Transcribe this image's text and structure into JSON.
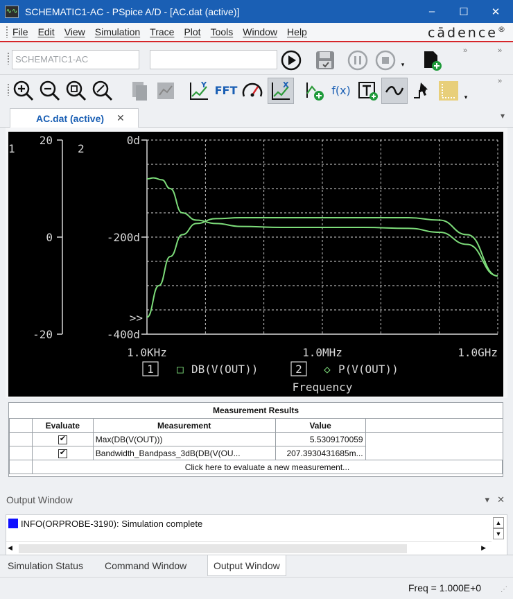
{
  "window": {
    "title": "SCHEMATIC1-AC - PSpice A/D  - [AC.dat (active)]",
    "minimize": "–",
    "maximize": "☐",
    "close": "✕"
  },
  "menu": {
    "items": [
      "File",
      "Edit",
      "View",
      "Simulation",
      "Trace",
      "Plot",
      "Tools",
      "Window",
      "Help"
    ],
    "brand": "cādence",
    "brand_mark": "®"
  },
  "toolbar": {
    "profile_value": "SCHEMATIC1-AC",
    "second_combo_value": "",
    "fft_label": "FFT",
    "fx_label": "f(x)",
    "chevron": "»"
  },
  "tabs": {
    "active_label": "AC.dat (active)",
    "close": "✕",
    "dropdown": "▾"
  },
  "plot": {
    "axis1_id": "1",
    "axis2_id": "2",
    "y1_ticks": [
      "20",
      "0",
      "-20"
    ],
    "y2_ticks": [
      "0d",
      "-200d",
      "-400d"
    ],
    "x_ticks": [
      "1.0KHz",
      "1.0MHz",
      "1.0GHz"
    ],
    "overflow_marker": ">>",
    "legend": [
      {
        "id": "1",
        "symbol": "□",
        "label": "DB(V(OUT))"
      },
      {
        "id": "2",
        "symbol": "◇",
        "label": "P(V(OUT))"
      }
    ],
    "xlabel": "Frequency",
    "colors": {
      "background": "#000000",
      "trace": "#7ddc7a",
      "axis": "#d8d8d8",
      "grid": "#d8d8d8"
    }
  },
  "chart_data": {
    "type": "line",
    "xlabel": "Frequency",
    "xscale": "log",
    "xlim": [
      1000,
      1000000000
    ],
    "y_axes": [
      {
        "id": "1",
        "ylim": [
          -20,
          20
        ],
        "ticks": [
          20,
          0,
          -20
        ]
      },
      {
        "id": "2",
        "ylim": [
          -400,
          0
        ],
        "ticks": [
          "0d",
          "-200d",
          "-400d"
        ]
      }
    ],
    "grid": true,
    "series": [
      {
        "name": "DB(V(OUT))",
        "axis": "1",
        "x": [
          1000,
          1600,
          2500,
          4000,
          7000,
          15000,
          40000,
          200000,
          1000000,
          5000000,
          30000000,
          100000000,
          300000000,
          1000000000
        ],
        "y": [
          -16.5,
          -10.0,
          -4.0,
          0.5,
          2.8,
          3.8,
          4.0,
          4.0,
          4.0,
          4.0,
          4.0,
          3.5,
          0.5,
          -8.0
        ]
      },
      {
        "name": "P(V(OUT))",
        "axis": "2",
        "x": [
          1000,
          1300,
          1800,
          2500,
          4000,
          7000,
          15000,
          40000,
          200000,
          1000000,
          5000000,
          30000000,
          100000000,
          300000000,
          1000000000
        ],
        "y": [
          -80,
          -78,
          -82,
          -100,
          -150,
          -165,
          -172,
          -178,
          -180,
          -180,
          -180,
          -182,
          -190,
          -215,
          -280
        ]
      }
    ]
  },
  "measurements": {
    "title": "Measurement Results",
    "columns": [
      "Evaluate",
      "Measurement",
      "Value"
    ],
    "rows": [
      {
        "evaluate": true,
        "measurement": "Max(DB(V(OUT)))",
        "value": "5.5309170059"
      },
      {
        "evaluate": true,
        "measurement": "Bandwidth_Bandpass_3dB(DB(V(OU...",
        "value": "207.3930431685m..."
      }
    ],
    "add_prompt": "Click here to evaluate a new measurement..."
  },
  "output_window": {
    "title": "Output Window",
    "pin": "▾",
    "close": "✕",
    "message": "INFO(ORPROBE-3190): Simulation complete",
    "message_color": "#1010ff"
  },
  "bottom_tabs": [
    "Simulation Status",
    "Command Window",
    "Output Window"
  ],
  "status": {
    "freq": "Freq  =  1.000E+0"
  }
}
